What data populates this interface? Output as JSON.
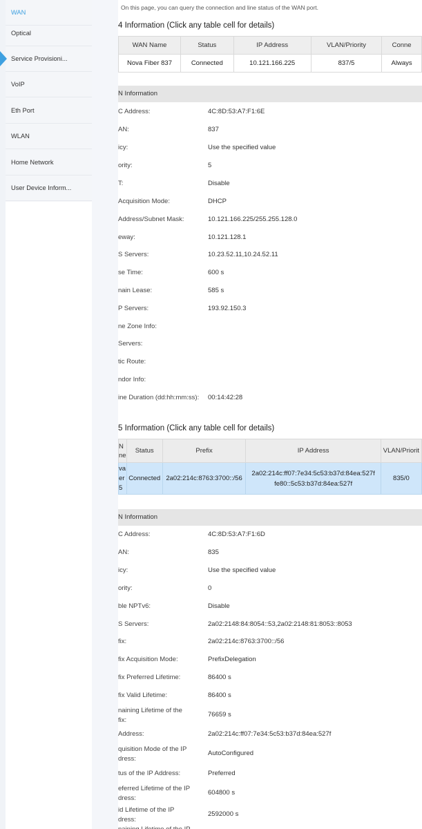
{
  "nav": {
    "items": [
      {
        "label": "WAN",
        "active": true
      },
      {
        "label": "Optical"
      },
      {
        "label": "Service Provisioni..."
      },
      {
        "label": "VoIP"
      },
      {
        "label": "Eth Port"
      },
      {
        "label": "WLAN"
      },
      {
        "label": "Home Network"
      },
      {
        "label": "User Device Inform..."
      }
    ]
  },
  "page": {
    "intro": "On this page, you can query the connection and line status of the WAN port."
  },
  "ipv4": {
    "title": "4 Information (Click any table cell for details)",
    "headers": [
      "WAN Name",
      "Status",
      "IP Address",
      "VLAN/Priority",
      "Conne"
    ],
    "row": [
      "Nova Fiber 837",
      "Connected",
      "10.121.166.225",
      "837/5",
      "Always"
    ],
    "info_header": "N Information",
    "rows": [
      {
        "label": "C Address:",
        "value": "4C:8D:53:A7:F1:6E"
      },
      {
        "label": "AN:",
        "value": "837"
      },
      {
        "label": "icy:",
        "value": "Use the specified value"
      },
      {
        "label": "ority:",
        "value": "5"
      },
      {
        "label": "T:",
        "value": "Disable"
      },
      {
        "label": "Acquisition Mode:",
        "value": "DHCP"
      },
      {
        "label": "Address/Subnet Mask:",
        "value": "10.121.166.225/255.255.128.0"
      },
      {
        "label": "eway:",
        "value": "10.121.128.1"
      },
      {
        "label": "S Servers:",
        "value": "10.23.52.11,10.24.52.11"
      },
      {
        "label": "se Time:",
        "value": "600 s"
      },
      {
        "label": "nain Lease:",
        "value": "585 s"
      },
      {
        "label": "P Servers:",
        "value": "193.92.150.3"
      },
      {
        "label": "ne Zone Info:",
        "value": ""
      },
      {
        "label": "Servers:",
        "value": ""
      },
      {
        "label": "tic Route:",
        "value": ""
      },
      {
        "label": "ndor Info:",
        "value": ""
      },
      {
        "label": "ine Duration (dd:hh:mm:ss):",
        "value": "00:14:42:28"
      }
    ]
  },
  "ipv6": {
    "title": "5 Information (Click any table cell for details)",
    "headers": [
      "N\nne",
      "Status",
      "Prefix",
      "IP Address",
      "VLAN/Priorit"
    ],
    "row": [
      "va\ner\n5",
      "Connected",
      "2a02:214c:8763:3700::/56",
      "2a02:214c:ff07:7e34:5c53:b37d:84ea:527f\nfe80::5c53:b37d:84ea:527f",
      "835/0"
    ],
    "info_header": "N Information",
    "rows": [
      {
        "label": "C Address:",
        "value": "4C:8D:53:A7:F1:6D"
      },
      {
        "label": "AN:",
        "value": "835"
      },
      {
        "label": "icy:",
        "value": "Use the specified value"
      },
      {
        "label": "ority:",
        "value": "0"
      },
      {
        "label": "ble NPTv6:",
        "value": "Disable"
      },
      {
        "label": "S Servers:",
        "value": "2a02:2148:84:8054::53,2a02:2148:81:8053::8053"
      },
      {
        "label": "fix:",
        "value": "2a02:214c:8763:3700::/56"
      },
      {
        "label": "fix Acquisition Mode:",
        "value": "PrefixDelegation"
      },
      {
        "label": "fix Preferred Lifetime:",
        "value": "86400 s"
      },
      {
        "label": "fix Valid Lifetime:",
        "value": "86400 s"
      },
      {
        "label": "naining Lifetime of the\nfix:",
        "value": "76659 s"
      },
      {
        "label": "Address:",
        "value": "2a02:214c:ff07:7e34:5c53:b37d:84ea:527f"
      },
      {
        "label": "quisition Mode of the IP\ndress:",
        "value": "AutoConfigured"
      },
      {
        "label": "tus of the IP Address:",
        "value": "Preferred"
      },
      {
        "label": "eferred Lifetime of the IP\ndress:",
        "value": "604800 s"
      },
      {
        "label": "id Lifetime of the IP\ndress:",
        "value": "2592000 s"
      },
      {
        "label": "naining Lifetime of the IP",
        "value": ""
      }
    ]
  },
  "colors": {
    "accent": "#3ea0e0",
    "selected_row": "#cfe6fa",
    "header_bg": "#e5e5e5"
  }
}
